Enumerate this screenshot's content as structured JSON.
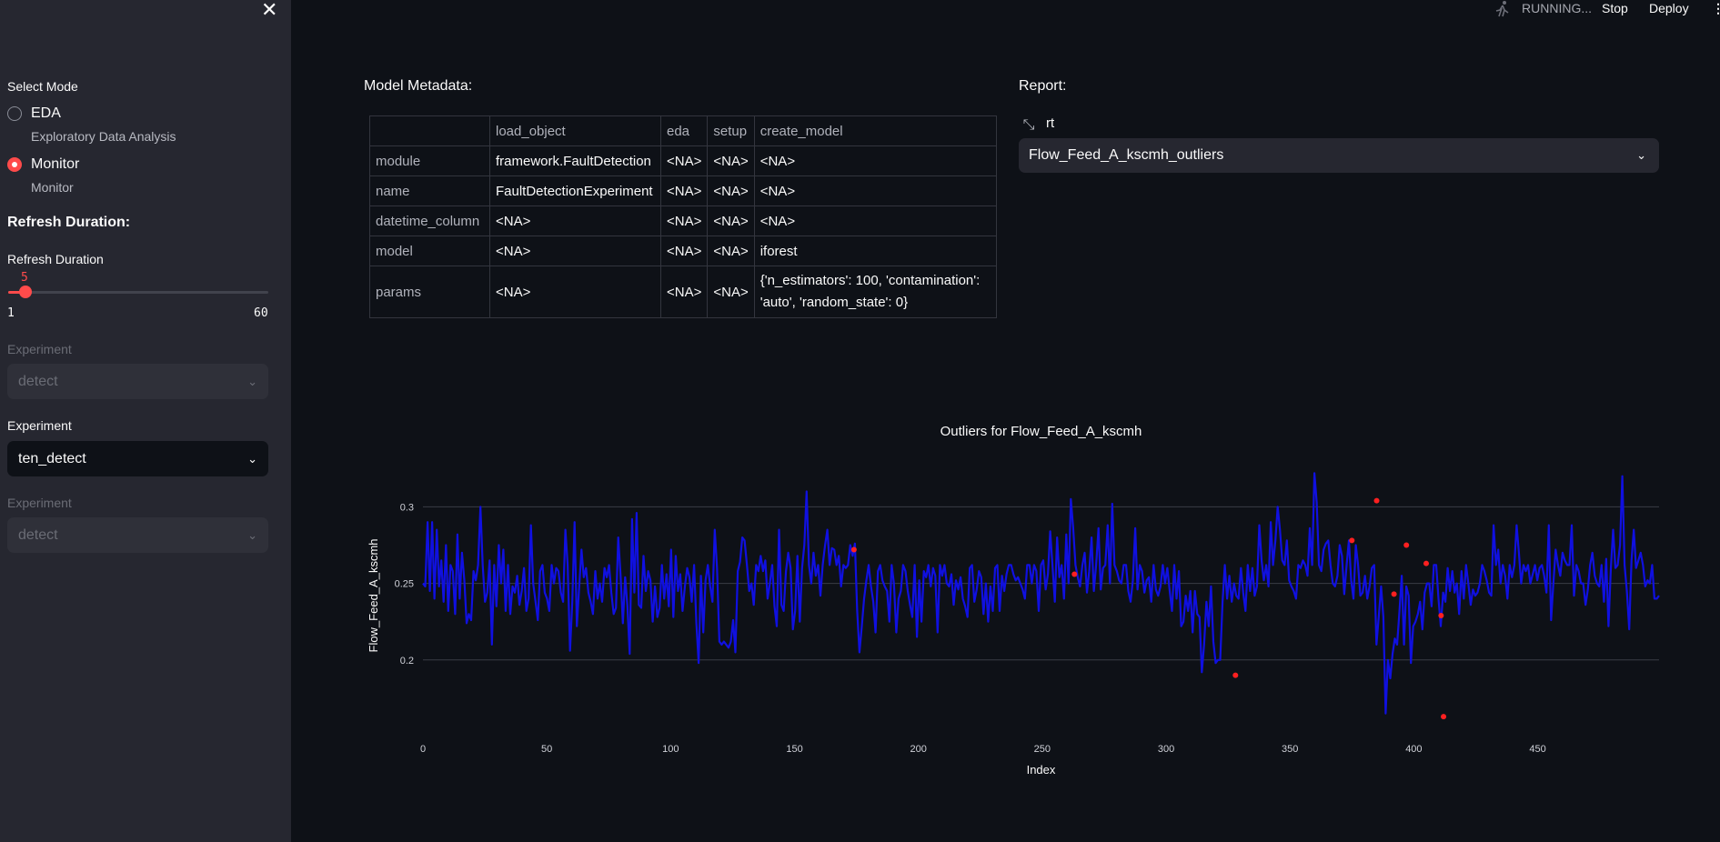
{
  "sidebar": {
    "close_icon": "close-icon",
    "select_mode_label": "Select Mode",
    "modes": [
      {
        "label": "EDA",
        "caption": "Exploratory Data Analysis",
        "selected": false
      },
      {
        "label": "Monitor",
        "caption": "Monitor",
        "selected": true
      }
    ],
    "refresh_heading": "Refresh Duration:",
    "slider": {
      "label": "Refresh Duration",
      "value": "5",
      "min": "1",
      "max": "60",
      "value_num": 5
    },
    "experiments": [
      {
        "label": "Experiment",
        "value": "detect",
        "disabled": true
      },
      {
        "label": "Experiment",
        "value": "ten_detect",
        "disabled": false
      },
      {
        "label": "Experiment",
        "value": "detect",
        "disabled": true
      }
    ]
  },
  "topbar": {
    "status": "RUNNING...",
    "stop": "Stop",
    "deploy": "Deploy",
    "status_icon": "running-man-icon",
    "menu_icon": "kebab-menu-icon"
  },
  "metadata": {
    "title": "Model Metadata:",
    "columns": [
      "",
      "load_object",
      "eda",
      "setup",
      "create_model"
    ],
    "rows": [
      [
        "module",
        "framework.FaultDetection",
        "<NA>",
        "<NA>",
        "<NA>"
      ],
      [
        "name",
        "FaultDetectionExperiment",
        "<NA>",
        "<NA>",
        "<NA>"
      ],
      [
        "datetime_column",
        "<NA>",
        "<NA>",
        "<NA>",
        "<NA>"
      ],
      [
        "model",
        "<NA>",
        "<NA>",
        "<NA>",
        "iforest"
      ],
      [
        "params",
        "<NA>",
        "<NA>",
        "<NA>",
        "{'n_estimators': 100, 'contamination':|'auto', 'random_state': 0}"
      ]
    ]
  },
  "report": {
    "title": "Report:",
    "select_label": "rt",
    "selected": "Flow_Feed_A_kscmh_outliers",
    "expand_icon": "expand-icon"
  },
  "chart_data": {
    "type": "line",
    "title": "Outliers for Flow_Feed_A_kscmh",
    "xlabel": "Index",
    "ylabel": "Flow_Feed_A_kscmh",
    "xlim": [
      0,
      499
    ],
    "ylim": [
      0.15,
      0.34
    ],
    "xticks": [
      "0",
      "50",
      "100",
      "150",
      "200",
      "250",
      "300",
      "350",
      "400",
      "450"
    ],
    "yticks": [
      "0.2",
      "0.25",
      "0.3"
    ],
    "grid": true,
    "line_color": "#1010e0",
    "outlier_color": "#ff2020",
    "series": [
      {
        "values": [
          0.25,
          0.248,
          0.29,
          0.245,
          0.29,
          0.24,
          0.285,
          0.248,
          0.265,
          0.238,
          0.275,
          0.232,
          0.262,
          0.258,
          0.23,
          0.282,
          0.24,
          0.27,
          0.252,
          0.224,
          0.23,
          0.226,
          0.258,
          0.252,
          0.262,
          0.3,
          0.262,
          0.238,
          0.244,
          0.265,
          0.21,
          0.262,
          0.235,
          0.275,
          0.25,
          0.272,
          0.232,
          0.262,
          0.23,
          0.248,
          0.244,
          0.255,
          0.236,
          0.245,
          0.26,
          0.232,
          0.24,
          0.288,
          0.25,
          0.238,
          0.226,
          0.258,
          0.262,
          0.244,
          0.24,
          0.232,
          0.262,
          0.25,
          0.26,
          0.258,
          0.244,
          0.238,
          0.285,
          0.262,
          0.206,
          0.238,
          0.29,
          0.222,
          0.248,
          0.272,
          0.254,
          0.26,
          0.244,
          0.238,
          0.23,
          0.258,
          0.24,
          0.25,
          0.238,
          0.26,
          0.254,
          0.262,
          0.244,
          0.23,
          0.234,
          0.28,
          0.256,
          0.224,
          0.254,
          0.235,
          0.204,
          0.292,
          0.244,
          0.296,
          0.236,
          0.234,
          0.268,
          0.245,
          0.258,
          0.252,
          0.225,
          0.248,
          0.228,
          0.234,
          0.262,
          0.24,
          0.256,
          0.235,
          0.272,
          0.228,
          0.268,
          0.245,
          0.256,
          0.232,
          0.248,
          0.26,
          0.254,
          0.238,
          0.262,
          0.224,
          0.198,
          0.255,
          0.218,
          0.252,
          0.262,
          0.248,
          0.238,
          0.285,
          0.26,
          0.212,
          0.21,
          0.212,
          0.21,
          0.208,
          0.212,
          0.226,
          0.205,
          0.258,
          0.264,
          0.28,
          0.278,
          0.262,
          0.245,
          0.25,
          0.236,
          0.262,
          0.258,
          0.268,
          0.258,
          0.265,
          0.24,
          0.25,
          0.262,
          0.235,
          0.222,
          0.285,
          0.236,
          0.232,
          0.258,
          0.27,
          0.26,
          0.22,
          0.232,
          0.268,
          0.225,
          0.26,
          0.275,
          0.31,
          0.262,
          0.25,
          0.27,
          0.255,
          0.262,
          0.242,
          0.262,
          0.275,
          0.285,
          0.262,
          0.273,
          0.272,
          0.262,
          0.268,
          0.248,
          0.262,
          0.26,
          0.262,
          0.275,
          0.268,
          0.276,
          0.232,
          0.205,
          0.222,
          0.24,
          0.252,
          0.262,
          0.248,
          0.238,
          0.218,
          0.258,
          0.262,
          0.252,
          0.248,
          0.245,
          0.225,
          0.262,
          0.25,
          0.218,
          0.24,
          0.245,
          0.262,
          0.258,
          0.245,
          0.236,
          0.228,
          0.262,
          0.215,
          0.252,
          0.225,
          0.258,
          0.254,
          0.262,
          0.248,
          0.26,
          0.255,
          0.218,
          0.262,
          0.255,
          0.262,
          0.25,
          0.248,
          0.256,
          0.236,
          0.252,
          0.246,
          0.254,
          0.24,
          0.235,
          0.228,
          0.26,
          0.262,
          0.238,
          0.246,
          0.258,
          0.254,
          0.23,
          0.25,
          0.225,
          0.248,
          0.232,
          0.26,
          0.262,
          0.232,
          0.255,
          0.245,
          0.256,
          0.262,
          0.262,
          0.256,
          0.252,
          0.254,
          0.25,
          0.246,
          0.24,
          0.262,
          0.262,
          0.25,
          0.262,
          0.258,
          0.232,
          0.262,
          0.265,
          0.246,
          0.256,
          0.284,
          0.262,
          0.238,
          0.28,
          0.254,
          0.262,
          0.24,
          0.282,
          0.25,
          0.305,
          0.286,
          0.262,
          0.254,
          0.248,
          0.262,
          0.27,
          0.244,
          0.258,
          0.28,
          0.245,
          0.262,
          0.286,
          0.246,
          0.26,
          0.262,
          0.288,
          0.25,
          0.302,
          0.262,
          0.258,
          0.252,
          0.25,
          0.262,
          0.262,
          0.245,
          0.238,
          0.252,
          0.286,
          0.246,
          0.262,
          0.258,
          0.244,
          0.252,
          0.254,
          0.238,
          0.262,
          0.246,
          0.242,
          0.248,
          0.262,
          0.25,
          0.26,
          0.245,
          0.232,
          0.262,
          0.24,
          0.258,
          0.222,
          0.225,
          0.242,
          0.232,
          0.245,
          0.218,
          0.245,
          0.23,
          0.228,
          0.192,
          0.21,
          0.238,
          0.222,
          0.248,
          0.212,
          0.198,
          0.2,
          0.2,
          0.238,
          0.262,
          0.24,
          0.255,
          0.238,
          0.25,
          0.242,
          0.24,
          0.26,
          0.244,
          0.232,
          0.262,
          0.245,
          0.26,
          0.242,
          0.248,
          0.288,
          0.265,
          0.252,
          0.262,
          0.248,
          0.29,
          0.262,
          0.278,
          0.3,
          0.285,
          0.265,
          0.262,
          0.278,
          0.252,
          0.248,
          0.245,
          0.24,
          0.262,
          0.26,
          0.265,
          0.262,
          0.255,
          0.286,
          0.262,
          0.322,
          0.303,
          0.262,
          0.258,
          0.272,
          0.276,
          0.278,
          0.262,
          0.25,
          0.248,
          0.255,
          0.275,
          0.268,
          0.243,
          0.262,
          0.278,
          0.252,
          0.24,
          0.275,
          0.262,
          0.242,
          0.244,
          0.255,
          0.24,
          0.248,
          0.26,
          0.262,
          0.21,
          0.228,
          0.248,
          0.228,
          0.165,
          0.2,
          0.188,
          0.204,
          0.214,
          0.21,
          0.232,
          0.255,
          0.21,
          0.248,
          0.242,
          0.198,
          0.222,
          0.225,
          0.23,
          0.238,
          0.22,
          0.244,
          0.25,
          0.25,
          0.235,
          0.262,
          0.262,
          0.24,
          0.222,
          0.244,
          0.238,
          0.26,
          0.245,
          0.258,
          0.244,
          0.25,
          0.23,
          0.258,
          0.24,
          0.262,
          0.25,
          0.236,
          0.246,
          0.242,
          0.244,
          0.25,
          0.262,
          0.258,
          0.252,
          0.244,
          0.242,
          0.288,
          0.262,
          0.272,
          0.25,
          0.262,
          0.255,
          0.24,
          0.262,
          0.254,
          0.262,
          0.288,
          0.27,
          0.25,
          0.262,
          0.258,
          0.262,
          0.25,
          0.256,
          0.262,
          0.252,
          0.26,
          0.262,
          0.255,
          0.244,
          0.288,
          0.226,
          0.25,
          0.272,
          0.262,
          0.255,
          0.27,
          0.265,
          0.262,
          0.262,
          0.288,
          0.242,
          0.262,
          0.258,
          0.25,
          0.25,
          0.236,
          0.246,
          0.262,
          0.27,
          0.255,
          0.25,
          0.248,
          0.262,
          0.238,
          0.266,
          0.222,
          0.26,
          0.285,
          0.26,
          0.262,
          0.275,
          0.32,
          0.262,
          0.245,
          0.22,
          0.265,
          0.285,
          0.26,
          0.265,
          0.27,
          0.262,
          0.248,
          0.252,
          0.25,
          0.262,
          0.24,
          0.24,
          0.242
        ]
      }
    ],
    "outliers": {
      "x": [
        174,
        263,
        328,
        375,
        385,
        392,
        397,
        405,
        411,
        412
      ],
      "y": [
        0.272,
        0.256,
        0.19,
        0.278,
        0.304,
        0.243,
        0.275,
        0.263,
        0.229,
        0.163
      ]
    }
  }
}
